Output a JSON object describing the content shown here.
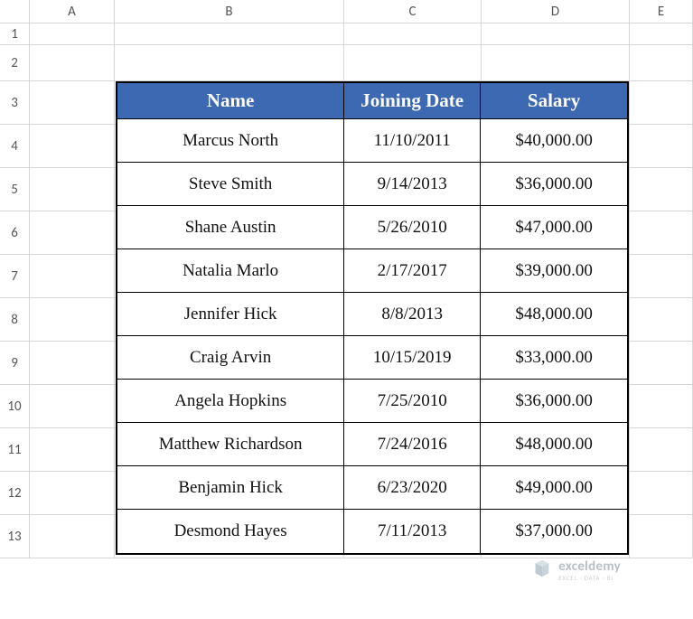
{
  "columns": [
    "A",
    "B",
    "C",
    "D",
    "E"
  ],
  "rows": [
    "1",
    "2",
    "3",
    "4",
    "5",
    "6",
    "7",
    "8",
    "9",
    "10",
    "11",
    "12",
    "13"
  ],
  "tableHeaders": {
    "name": "Name",
    "date": "Joining Date",
    "salary": "Salary"
  },
  "records": [
    {
      "name": "Marcus North",
      "date": "11/10/2011",
      "salary": "$40,000.00"
    },
    {
      "name": "Steve Smith",
      "date": "9/14/2013",
      "salary": "$36,000.00"
    },
    {
      "name": "Shane Austin",
      "date": "5/26/2010",
      "salary": "$47,000.00"
    },
    {
      "name": "Natalia Marlo",
      "date": "2/17/2017",
      "salary": "$39,000.00"
    },
    {
      "name": "Jennifer Hick",
      "date": "8/8/2013",
      "salary": "$48,000.00"
    },
    {
      "name": "Craig Arvin",
      "date": "10/15/2019",
      "salary": "$33,000.00"
    },
    {
      "name": "Angela Hopkins",
      "date": "7/25/2010",
      "salary": "$36,000.00"
    },
    {
      "name": "Matthew Richardson",
      "date": "7/24/2016",
      "salary": "$48,000.00"
    },
    {
      "name": "Benjamin Hick",
      "date": "6/23/2020",
      "salary": "$49,000.00"
    },
    {
      "name": "Desmond Hayes",
      "date": "7/11/2013",
      "salary": "$37,000.00"
    }
  ],
  "watermark": {
    "brand": "exceldemy",
    "tagline": "EXCEL · DATA · BI"
  },
  "chart_data": {
    "type": "table",
    "title": "",
    "columns": [
      "Name",
      "Joining Date",
      "Salary"
    ],
    "rows": [
      [
        "Marcus North",
        "11/10/2011",
        40000.0
      ],
      [
        "Steve Smith",
        "9/14/2013",
        36000.0
      ],
      [
        "Shane Austin",
        "5/26/2010",
        47000.0
      ],
      [
        "Natalia Marlo",
        "2/17/2017",
        39000.0
      ],
      [
        "Jennifer Hick",
        "8/8/2013",
        48000.0
      ],
      [
        "Craig Arvin",
        "10/15/2019",
        33000.0
      ],
      [
        "Angela Hopkins",
        "7/25/2010",
        36000.0
      ],
      [
        "Matthew Richardson",
        "7/24/2016",
        48000.0
      ],
      [
        "Benjamin Hick",
        "6/23/2020",
        49000.0
      ],
      [
        "Desmond Hayes",
        "7/11/2013",
        37000.0
      ]
    ]
  }
}
